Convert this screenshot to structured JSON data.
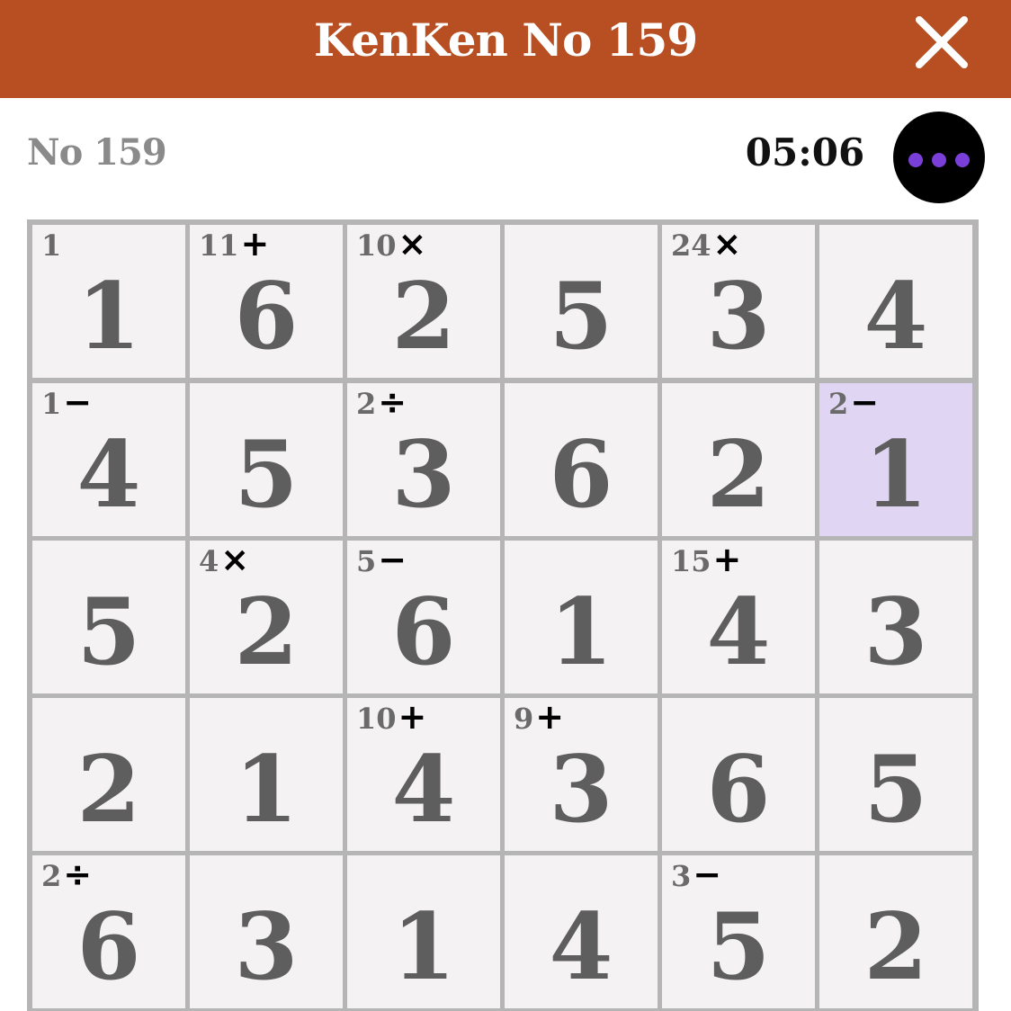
{
  "header": {
    "title": "KenKen No 159",
    "close_icon": "close-icon"
  },
  "toolbar": {
    "puzzle_number": "No 159",
    "timer": "05:06",
    "menu_icon": "more-options-icon"
  },
  "colors": {
    "header_bg": "#b84f22",
    "selected_cell": "#e0d6f3",
    "menu_dots": "#7a3fd8"
  },
  "grid": {
    "size": 6,
    "rows": [
      [
        {
          "value": "1",
          "clue": "1",
          "op": ""
        },
        {
          "value": "6",
          "clue": "11",
          "op": "+"
        },
        {
          "value": "2",
          "clue": "10",
          "op": "×"
        },
        {
          "value": "5",
          "clue": "",
          "op": ""
        },
        {
          "value": "3",
          "clue": "24",
          "op": "×"
        },
        {
          "value": "4",
          "clue": "",
          "op": ""
        }
      ],
      [
        {
          "value": "4",
          "clue": "1",
          "op": "−"
        },
        {
          "value": "5",
          "clue": "",
          "op": ""
        },
        {
          "value": "3",
          "clue": "2",
          "op": "÷"
        },
        {
          "value": "6",
          "clue": "",
          "op": ""
        },
        {
          "value": "2",
          "clue": "",
          "op": ""
        },
        {
          "value": "1",
          "clue": "2",
          "op": "−",
          "selected": true
        }
      ],
      [
        {
          "value": "5",
          "clue": "",
          "op": ""
        },
        {
          "value": "2",
          "clue": "4",
          "op": "×"
        },
        {
          "value": "6",
          "clue": "5",
          "op": "−"
        },
        {
          "value": "1",
          "clue": "",
          "op": ""
        },
        {
          "value": "4",
          "clue": "15",
          "op": "+"
        },
        {
          "value": "3",
          "clue": "",
          "op": ""
        }
      ],
      [
        {
          "value": "2",
          "clue": "",
          "op": ""
        },
        {
          "value": "1",
          "clue": "",
          "op": ""
        },
        {
          "value": "4",
          "clue": "10",
          "op": "+"
        },
        {
          "value": "3",
          "clue": "9",
          "op": "+"
        },
        {
          "value": "6",
          "clue": "",
          "op": ""
        },
        {
          "value": "5",
          "clue": "",
          "op": ""
        }
      ],
      [
        {
          "value": "6",
          "clue": "2",
          "op": "÷"
        },
        {
          "value": "3",
          "clue": "",
          "op": ""
        },
        {
          "value": "1",
          "clue": "",
          "op": ""
        },
        {
          "value": "4",
          "clue": "",
          "op": ""
        },
        {
          "value": "5",
          "clue": "3",
          "op": "−"
        },
        {
          "value": "2",
          "clue": "",
          "op": ""
        }
      ]
    ]
  }
}
